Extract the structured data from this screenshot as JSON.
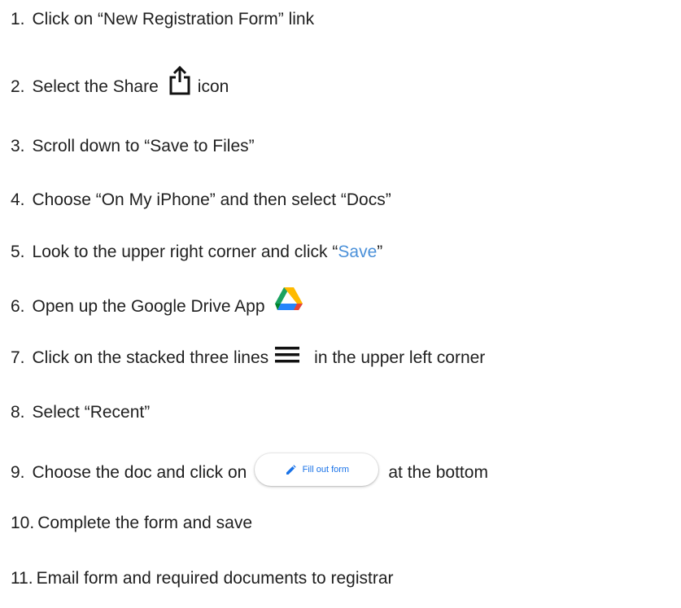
{
  "steps": [
    {
      "number": "1.",
      "text": "Click on “New Registration Form” link"
    },
    {
      "number": "2.",
      "text_before": "Select the Share",
      "text_after": "icon",
      "icon": "share-icon"
    },
    {
      "number": "3.",
      "text": "Scroll down to “Save to Files”"
    },
    {
      "number": "4.",
      "text": "Choose “On My iPhone” and then select “Docs”"
    },
    {
      "number": "5.",
      "text_before": "Look to the upper right corner and click “",
      "link_text": "Save",
      "text_after": "”",
      "accent_color": "#4a90d9"
    },
    {
      "number": "6.",
      "text": "Open up the Google Drive App",
      "icon": "google-drive-icon"
    },
    {
      "number": "7.",
      "text_before": "Click on the stacked three lines",
      "text_after": "in the upper left corner",
      "icon": "hamburger-menu-icon"
    },
    {
      "number": "8.",
      "text": "Select “Recent”"
    },
    {
      "number": "9.",
      "text_before": "Choose the doc and click on",
      "button_label": "Fill out form",
      "text_after": "at the bottom",
      "icon": "pencil-icon"
    },
    {
      "number": "10.",
      "text": "Complete the form and save"
    },
    {
      "number": "11.",
      "text": "Email form and required documents to registrar"
    }
  ]
}
